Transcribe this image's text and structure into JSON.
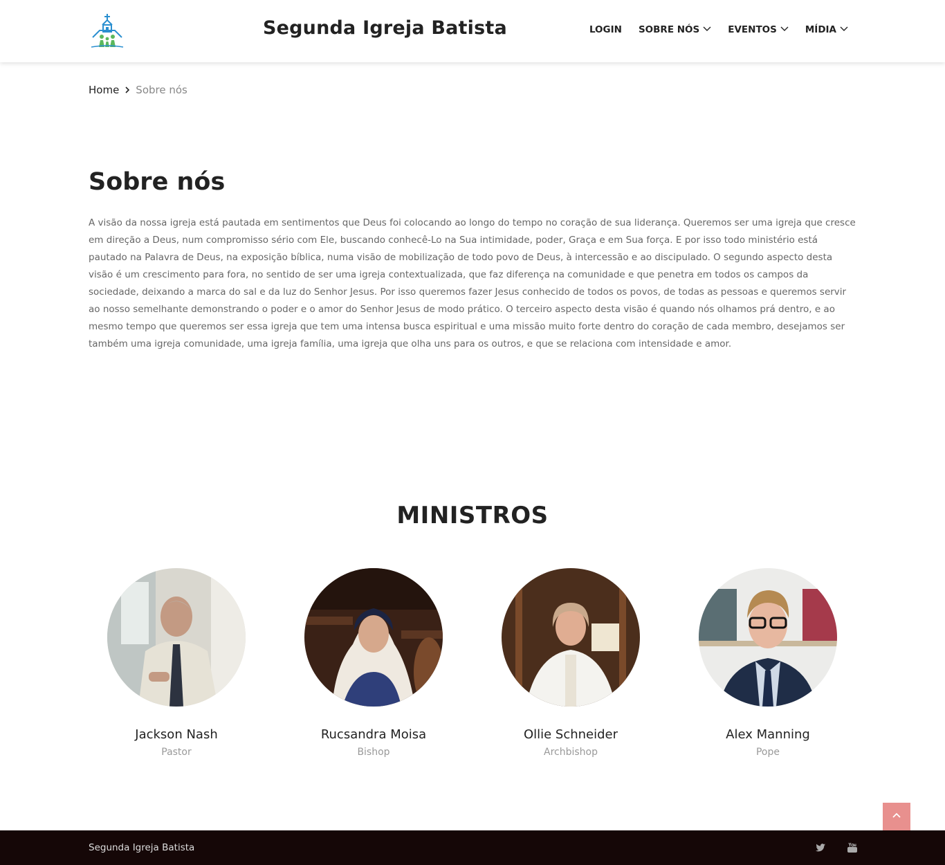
{
  "header": {
    "site_title": "Segunda Igreja Batista",
    "logo_icon": "church-logo-icon",
    "nav": [
      {
        "label": "LOGIN",
        "has_dropdown": false
      },
      {
        "label": "SOBRE NÓS",
        "has_dropdown": true
      },
      {
        "label": "EVENTOS",
        "has_dropdown": true
      },
      {
        "label": "MÍDIA",
        "has_dropdown": true
      }
    ]
  },
  "breadcrumb": {
    "home": "Home",
    "separator_icon": "chevron-right-icon",
    "current": "Sobre nós"
  },
  "about": {
    "title": "Sobre nós",
    "text": "A visão da nossa igreja está pautada em sentimentos que Deus foi colocando ao longo do tempo no coração de sua liderança. Queremos ser uma igreja que cresce em direção a Deus, num compromisso sério com Ele, buscando conhecê-Lo na Sua intimidade, poder, Graça e em Sua força. E por isso todo ministério está pautado na Palavra de Deus, na exposição bíblica, numa visão de mobilização de todo povo de Deus, à intercessão e ao discipulado. O segundo aspecto desta visão é um crescimento para fora, no sentido de ser uma igreja contextualizada, que faz diferença na comunidade e que penetra em todos os campos da sociedade, deixando a marca do sal e da luz do Senhor Jesus. Por isso queremos fazer Jesus conhecido de todos os povos, de todas as pessoas e queremos servir ao nosso semelhante demonstrando o poder e o amor do Senhor Jesus de modo prático. O terceiro aspecto desta visão é quando nós olhamos prá dentro, e ao mesmo tempo que queremos ser essa igreja que tem uma intensa busca espiritual e uma missão muito forte dentro do coração de cada membro, desejamos ser também uma igreja comunidade, uma igreja família, uma igreja que olha uns para os outros, e que se relaciona com intensidade e amor."
  },
  "ministers": {
    "title": "MINISTROS",
    "items": [
      {
        "name": "Jackson Nash",
        "role": "Pastor"
      },
      {
        "name": "Rucsandra Moisa",
        "role": "Bishop"
      },
      {
        "name": "Ollie Schneider",
        "role": "Archbishop"
      },
      {
        "name": "Alex Manning",
        "role": "Pope"
      }
    ]
  },
  "footer": {
    "text": "Segunda Igreja Batista",
    "social": [
      "twitter-icon",
      "youtube-icon"
    ]
  },
  "colors": {
    "accent": "#e8908e",
    "footer_bg": "#150707",
    "logo_blue": "#2a8fd0",
    "logo_green": "#5bb85c"
  }
}
